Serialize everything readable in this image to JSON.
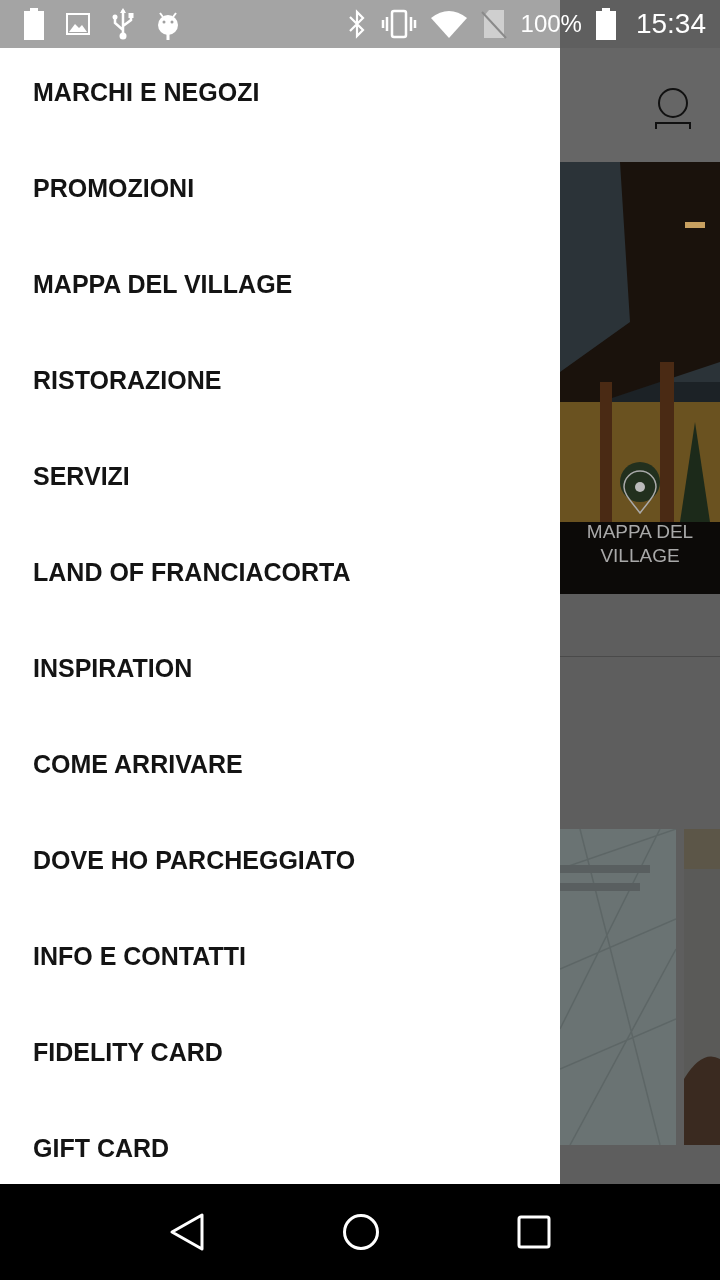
{
  "status_bar": {
    "battery": "100%",
    "time": "15:34"
  },
  "drawer": {
    "items": [
      {
        "label": "MARCHI E NEGOZI",
        "selected": false
      },
      {
        "label": "PROMOZIONI",
        "selected": false
      },
      {
        "label": "MAPPA DEL VILLAGE",
        "selected": false
      },
      {
        "label": "RISTORAZIONE",
        "selected": false
      },
      {
        "label": "SERVIZI",
        "selected": false
      },
      {
        "label": "LAND OF FRANCIACORTA",
        "selected": false
      },
      {
        "label": "INSPIRATION",
        "selected": false
      },
      {
        "label": "COME ARRIVARE",
        "selected": false
      },
      {
        "label": "DOVE HO PARCHEGGIATO",
        "selected": false
      },
      {
        "label": "INFO E CONTATTI",
        "selected": false
      },
      {
        "label": "FIDELITY CARD",
        "selected": false
      },
      {
        "label": "GIFT CARD",
        "selected": false
      }
    ]
  },
  "background_screen": {
    "banner": {
      "kind": "picture",
      "caption": "MAPPA DEL VILLAGE"
    }
  }
}
